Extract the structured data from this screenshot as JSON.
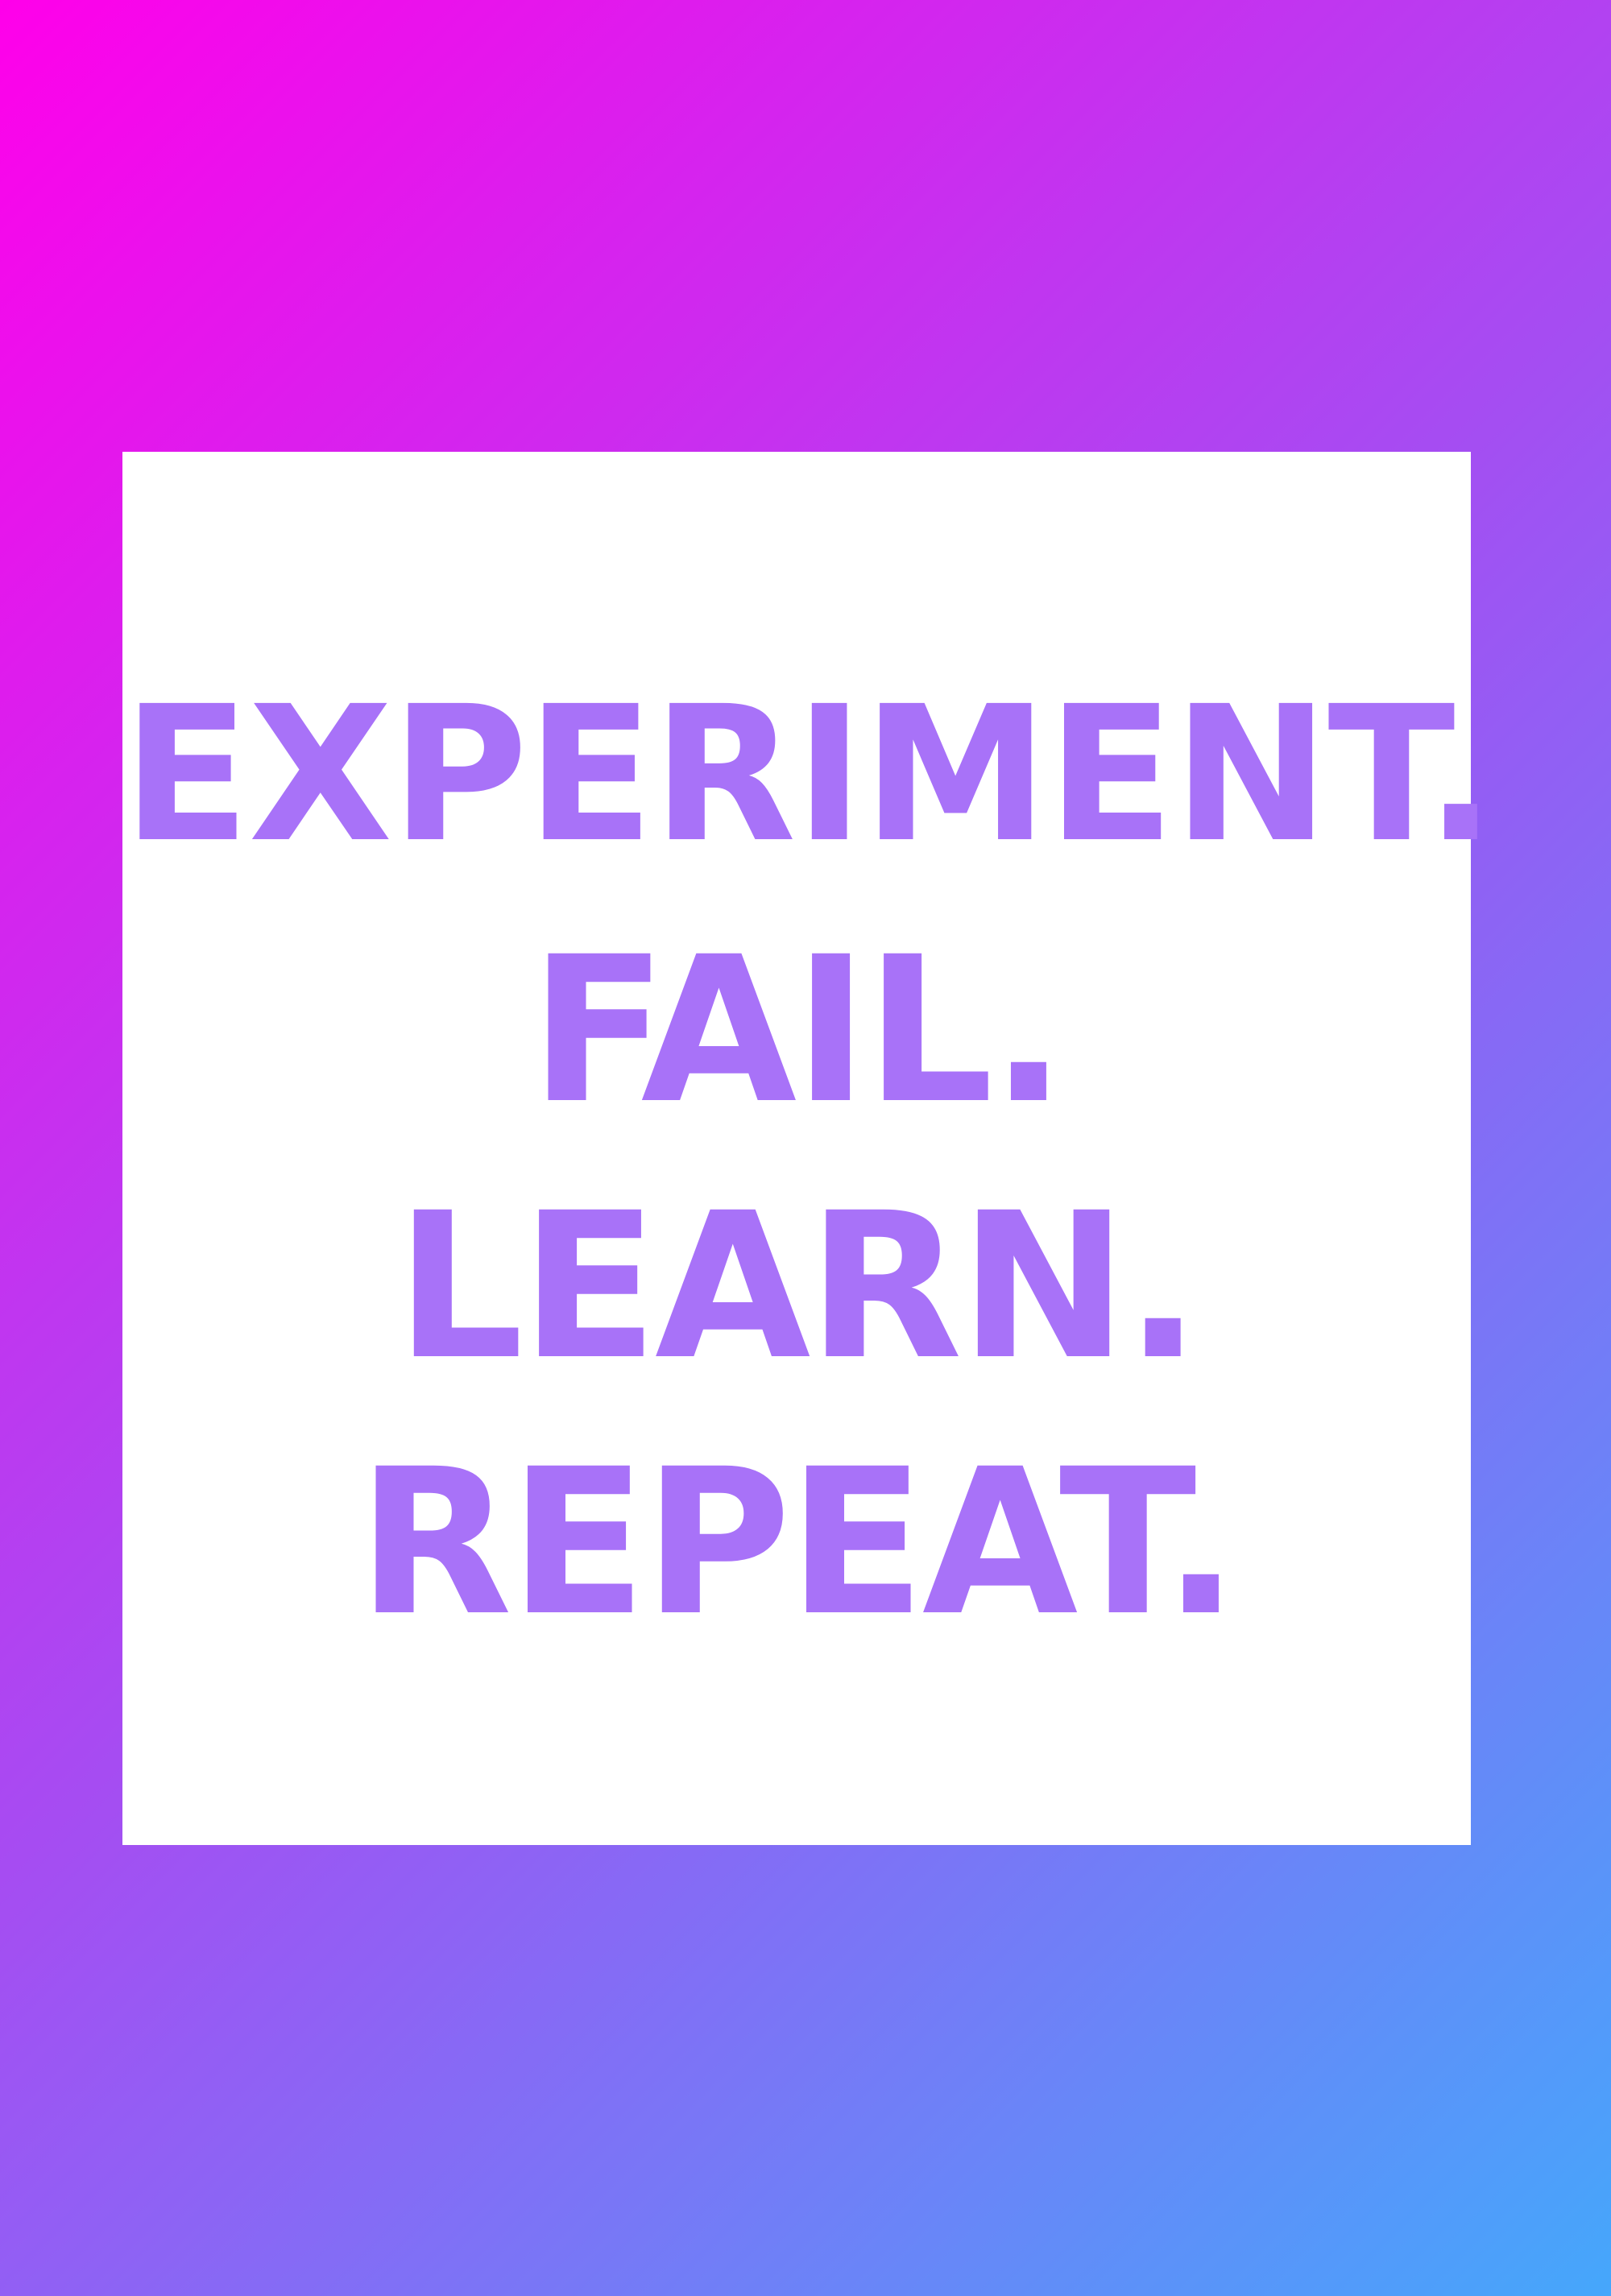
{
  "quote": {
    "lines": [
      "EXPERIMENT.",
      "FAIL.",
      "LEARN.",
      "REPEAT."
    ]
  },
  "colors": {
    "gradient_start": "#ff00ea",
    "gradient_mid": "#a64cf2",
    "gradient_end": "#45a7fb",
    "card_background": "#ffffff",
    "text": "#a872f8"
  }
}
